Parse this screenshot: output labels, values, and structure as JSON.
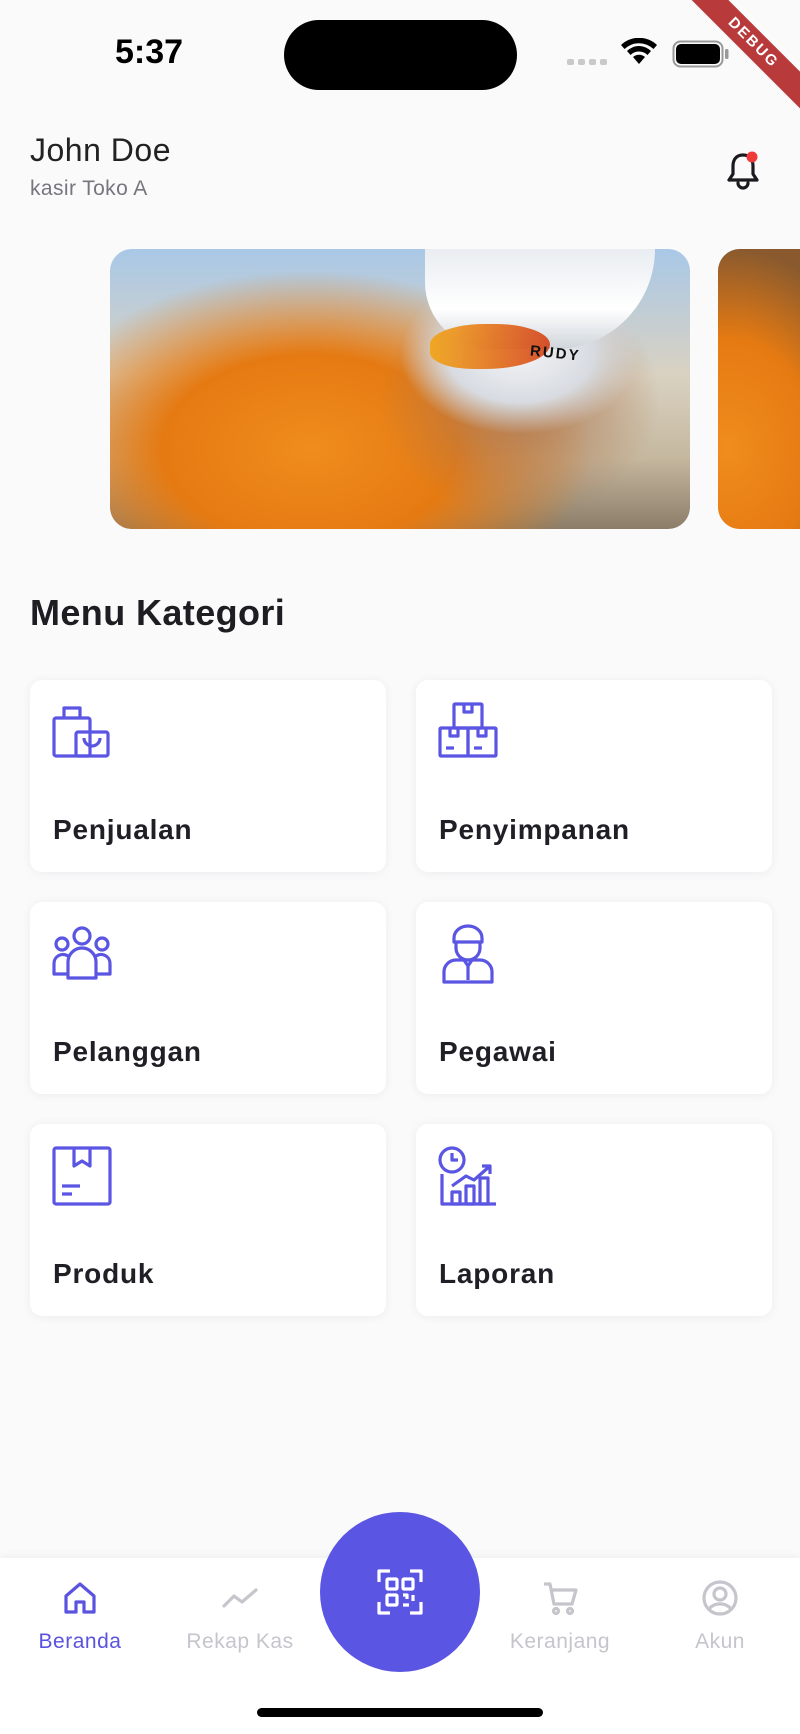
{
  "status_bar": {
    "time": "5:37",
    "debug_label": "DEBUG"
  },
  "header": {
    "user_name": "John Doe",
    "user_role": "kasir Toko A"
  },
  "carousel": {
    "helmet_brand": "RUDY"
  },
  "menu": {
    "title": "Menu Kategori",
    "items": [
      {
        "label": "Penjualan",
        "icon": "shopping-bag-icon"
      },
      {
        "label": "Penyimpanan",
        "icon": "stacked-boxes-icon"
      },
      {
        "label": "Pelanggan",
        "icon": "users-group-icon"
      },
      {
        "label": "Pegawai",
        "icon": "employee-icon"
      },
      {
        "label": "Produk",
        "icon": "product-box-icon"
      },
      {
        "label": "Laporan",
        "icon": "report-chart-icon"
      }
    ]
  },
  "bottom_nav": {
    "items": [
      {
        "label": "Beranda",
        "icon": "home-icon",
        "active": true
      },
      {
        "label": "Rekap Kas",
        "icon": "trend-line-icon",
        "active": false
      },
      {
        "label": "Keranjang",
        "icon": "cart-icon",
        "active": false
      },
      {
        "label": "Akun",
        "icon": "account-icon",
        "active": false
      }
    ],
    "fab_icon": "qr-scan-icon"
  },
  "colors": {
    "accent": "#5A55E3",
    "inactive": "#C6C5CC",
    "notification_dot": "#F03A3A"
  }
}
